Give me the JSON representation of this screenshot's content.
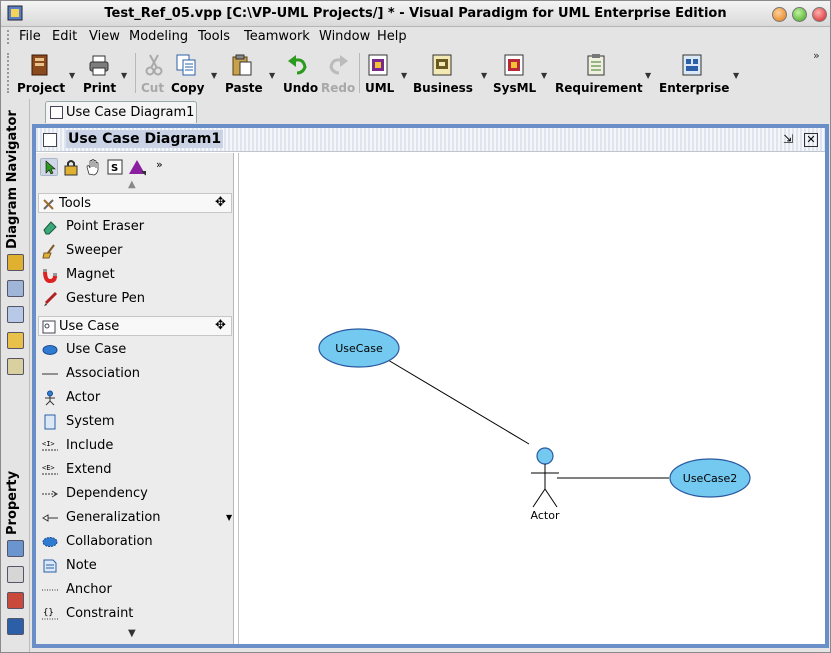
{
  "window": {
    "title": "Test_Ref_05.vpp [C:\\VP-UML Projects/] * - Visual Paradigm for UML Enterprise Edition"
  },
  "menu": [
    "File",
    "Edit",
    "View",
    "Modeling",
    "Tools",
    "Teamwork",
    "Window",
    "Help"
  ],
  "toolbar": {
    "project": "Project",
    "print": "Print",
    "cut": "Cut",
    "copy": "Copy",
    "paste": "Paste",
    "undo": "Undo",
    "redo": "Redo",
    "uml": "UML",
    "business": "Business",
    "sysml": "SysML",
    "requirement": "Requirement",
    "enterprise": "Enterprise",
    "more": "»"
  },
  "side_tabs": {
    "navigator": "Diagram Navigator",
    "property": "Property"
  },
  "doc_tab": "Use Case Diagram1",
  "frame_title": "Use Case Diagram1",
  "palette": {
    "more": "»",
    "tools_section": "Tools",
    "tools": [
      "Point Eraser",
      "Sweeper",
      "Magnet",
      "Gesture Pen"
    ],
    "usecase_section": "Use Case",
    "usecase_items": [
      "Use Case",
      "Association",
      "Actor",
      "System",
      "Include",
      "Extend",
      "Dependency",
      "Generalization",
      "Collaboration",
      "Note",
      "Anchor",
      "Constraint"
    ]
  },
  "diagram": {
    "usecase1": "UseCase",
    "usecase2": "UseCase2",
    "actor": "Actor",
    "usecase_fill": "#74c9f0",
    "stroke": "#2a5aa0"
  }
}
